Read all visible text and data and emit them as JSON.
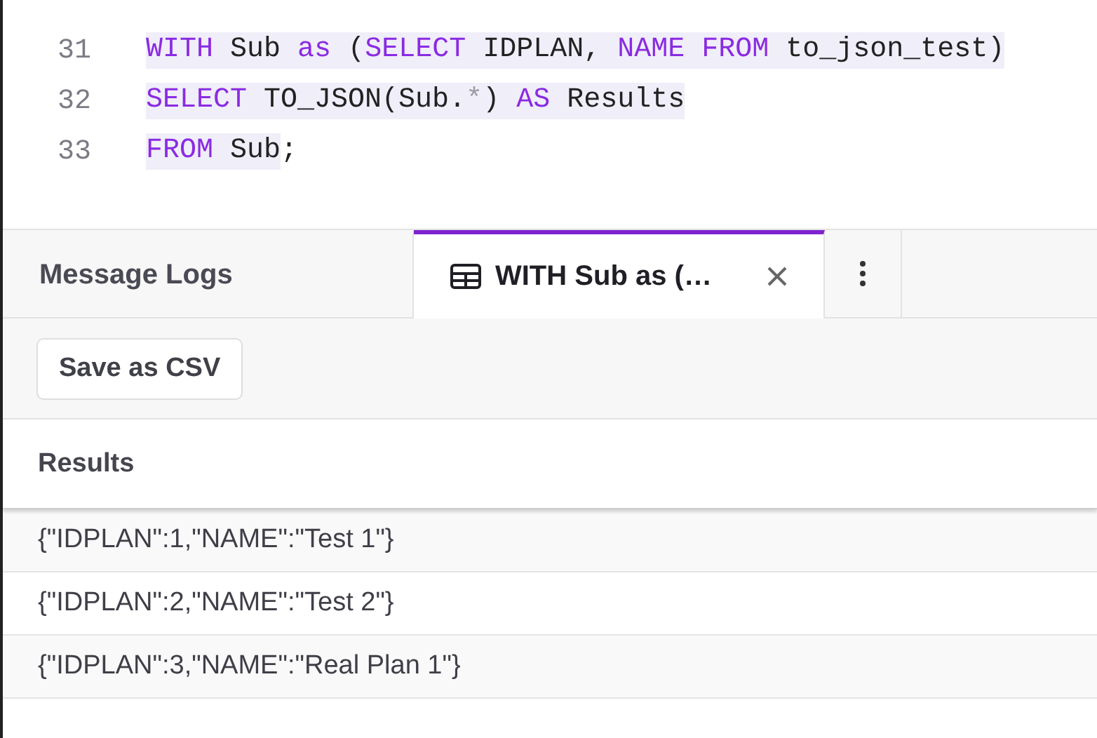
{
  "editor": {
    "lines": [
      {
        "number": "31",
        "tokens": [
          {
            "text": "WITH",
            "kind": "keyword",
            "selected": true
          },
          {
            "text": " Sub ",
            "kind": "plain",
            "selected": true
          },
          {
            "text": "as",
            "kind": "keyword",
            "selected": true
          },
          {
            "text": " (",
            "kind": "plain",
            "selected": true
          },
          {
            "text": "SELECT",
            "kind": "keyword",
            "selected": true
          },
          {
            "text": " IDPLAN, ",
            "kind": "plain",
            "selected": true
          },
          {
            "text": "NAME FROM",
            "kind": "keyword",
            "selected": true
          },
          {
            "text": " to_json_test)",
            "kind": "plain",
            "selected": true
          }
        ]
      },
      {
        "number": "32",
        "tokens": [
          {
            "text": "SELECT",
            "kind": "keyword",
            "selected": true
          },
          {
            "text": " TO_JSON(Sub.",
            "kind": "plain",
            "selected": true
          },
          {
            "text": "*",
            "kind": "operator",
            "selected": true
          },
          {
            "text": ") ",
            "kind": "plain",
            "selected": true
          },
          {
            "text": "AS",
            "kind": "keyword",
            "selected": true
          },
          {
            "text": " Results",
            "kind": "plain",
            "selected": true
          }
        ]
      },
      {
        "number": "33",
        "tokens": [
          {
            "text": "FROM",
            "kind": "keyword",
            "selected": true
          },
          {
            "text": " Sub",
            "kind": "plain",
            "selected": true
          },
          {
            "text": ";",
            "kind": "plain",
            "selected": false
          }
        ]
      }
    ]
  },
  "tabs": [
    {
      "label": "Message Logs",
      "kind": "text",
      "selected": false
    },
    {
      "label": "WITH Sub as (…",
      "kind": "result",
      "selected": true,
      "closable": true
    }
  ],
  "toolbar": {
    "buttons": [
      "Save as CSV"
    ]
  },
  "table": {
    "columns": [
      "Results"
    ],
    "rows": [
      [
        "{\"IDPLAN\":1,\"NAME\":\"Test 1\"}"
      ],
      [
        "{\"IDPLAN\":2,\"NAME\":\"Test 2\"}"
      ],
      [
        "{\"IDPLAN\":3,\"NAME\":\"Real Plan 1\"}"
      ]
    ]
  }
}
